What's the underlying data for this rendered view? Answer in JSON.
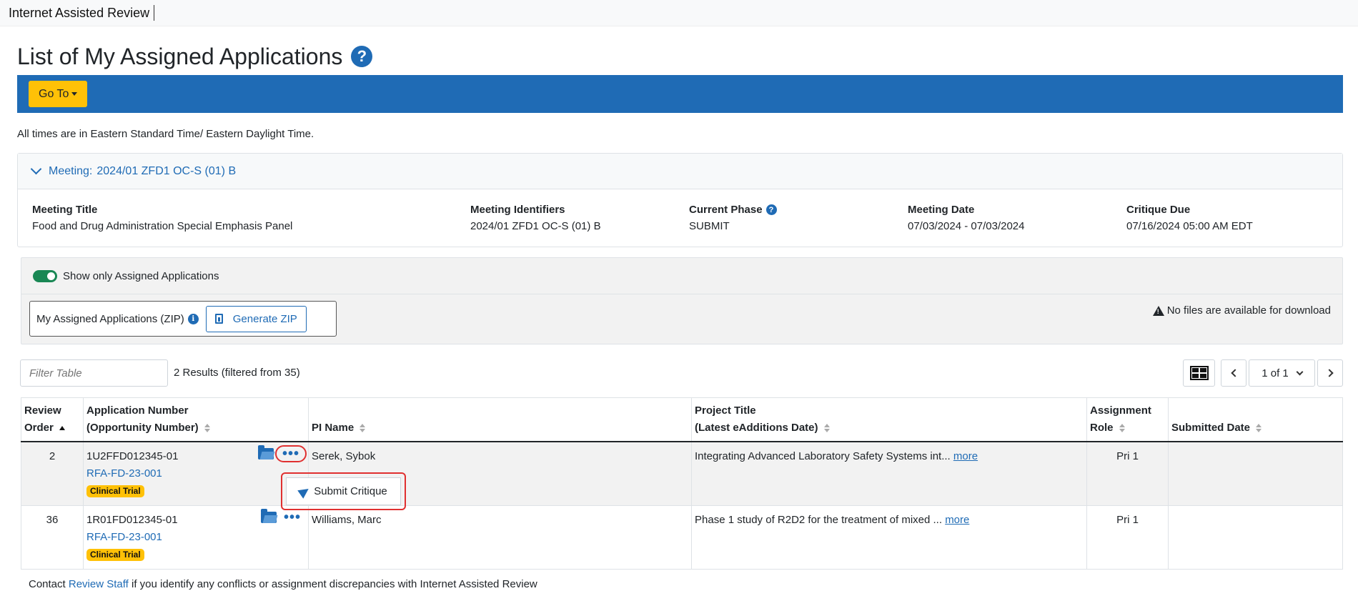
{
  "topbar": {
    "app_title": "Internet Assisted Review"
  },
  "page": {
    "title": "List of My Assigned Applications"
  },
  "toolbar": {
    "goto_label": "Go To"
  },
  "time_note": "All times are in Eastern Standard Time/ Eastern Daylight Time.",
  "meeting": {
    "header_label": "Meeting:",
    "header_value": "2024/01 ZFD1 OC-S (01) B",
    "columns": [
      {
        "label": "Meeting Title",
        "value": "Food and Drug Administration Special Emphasis Panel"
      },
      {
        "label": "Meeting Identifiers",
        "value": "2024/01 ZFD1 OC-S (01) B"
      },
      {
        "label": "Current Phase",
        "value": "SUBMIT"
      },
      {
        "label": "Meeting Date",
        "value": "07/03/2024 - 07/03/2024"
      },
      {
        "label": "Critique Due",
        "value": "07/16/2024 05:00 AM EDT"
      }
    ]
  },
  "filters": {
    "toggle_label": "Show only Assigned Applications",
    "zip_label": "My Assigned Applications (ZIP)",
    "generate_zip_label": "Generate ZIP",
    "no_files_text": "No files are available for download"
  },
  "table_controls": {
    "filter_placeholder": "Filter Table",
    "results_text": "2 Results (filtered from 35)",
    "page_indicator": "1 of 1"
  },
  "table": {
    "headers": {
      "review_order_1": "Review",
      "review_order_2": "Order",
      "app_number_1": "Application Number",
      "app_number_2": "(Opportunity Number)",
      "pi_name": "PI Name",
      "project_title_1": "Project Title",
      "project_title_2": "(Latest eAdditions Date)",
      "assignment_role_1": "Assignment",
      "assignment_role_2": "Role",
      "submitted_date": "Submitted Date"
    },
    "rows": [
      {
        "review_order": "2",
        "app_number": "1U2FFD012345-01",
        "opportunity": "RFA-FD-23-001",
        "badge": "Clinical Trial",
        "pi_name": "Serek, Sybok",
        "project_title": "Integrating Advanced Laboratory Safety Systems int...",
        "more": "more",
        "role": "Pri 1",
        "submitted": ""
      },
      {
        "review_order": "36",
        "app_number": "1R01FD012345-01",
        "opportunity": "RFA-FD-23-001",
        "badge": "Clinical Trial",
        "pi_name": "Williams, Marc",
        "project_title": "Phase 1 study of R2D2 for the treatment of mixed  ...",
        "more": "more",
        "role": "Pri 1",
        "submitted": ""
      }
    ]
  },
  "popup": {
    "submit_critique_label": "Submit Critique"
  },
  "footer": {
    "prefix": "Contact",
    "link": "Review Staff",
    "suffix": "if you identify any conflicts or assignment discrepancies with Internet Assisted Review"
  }
}
